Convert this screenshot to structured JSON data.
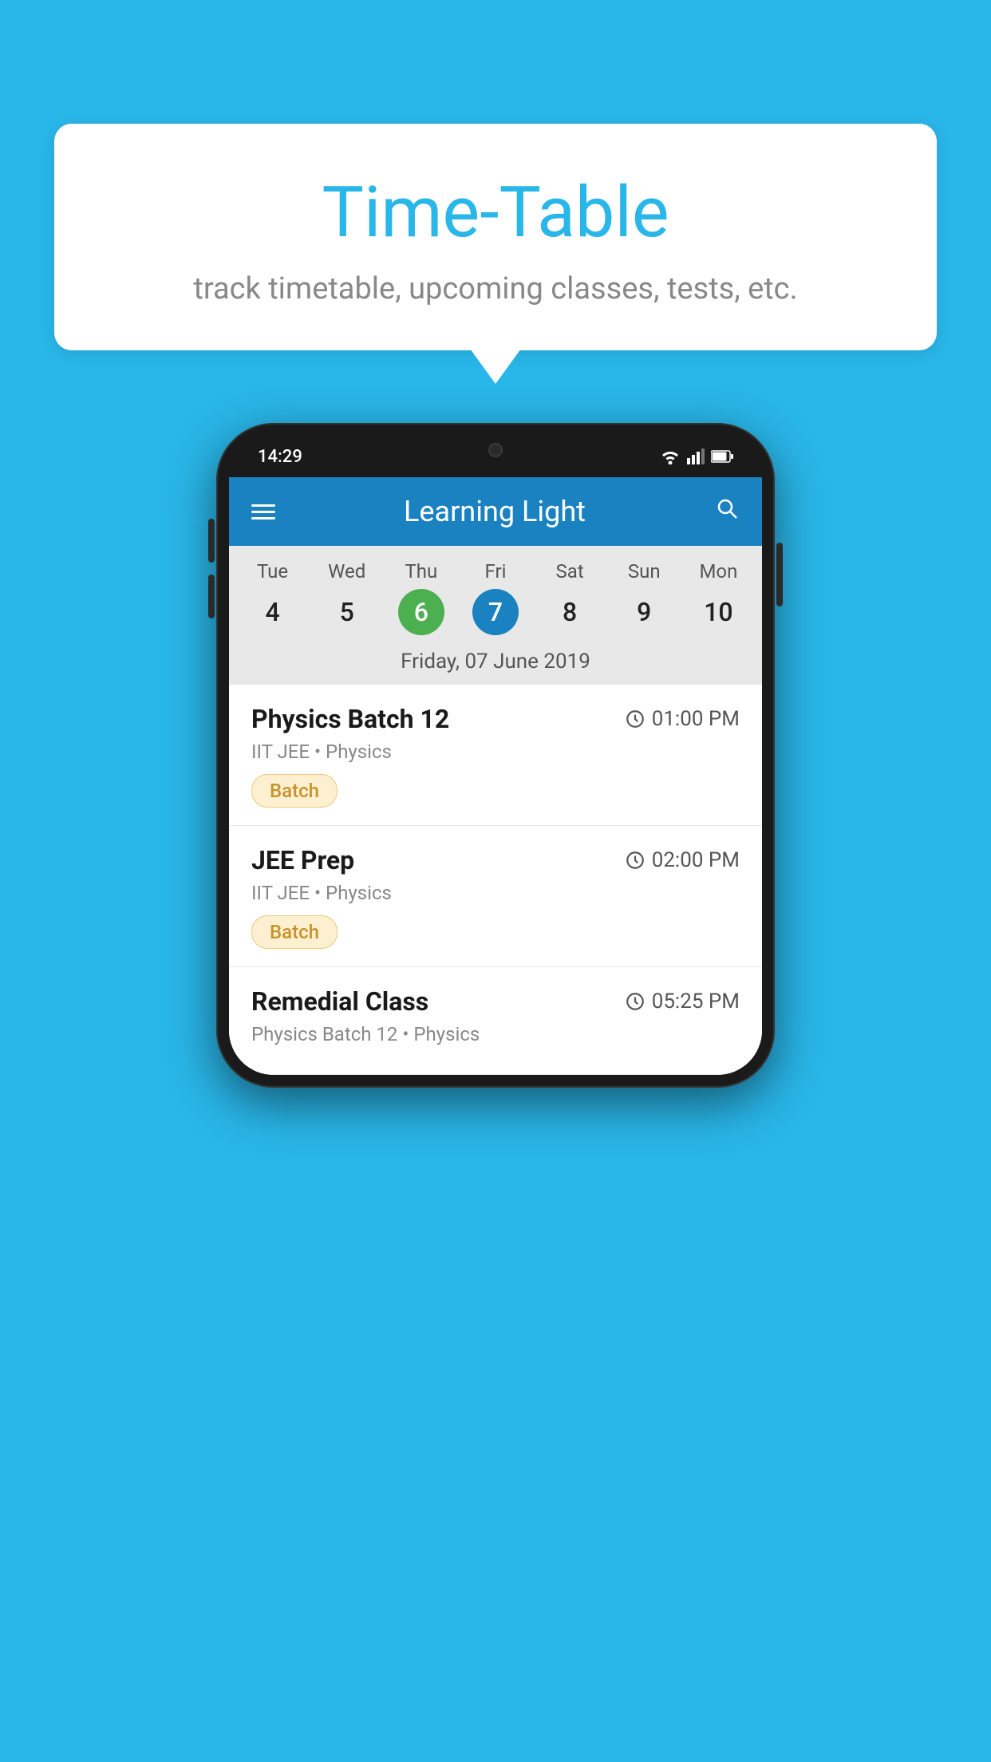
{
  "background_color": "#29b6e8",
  "speech_bubble": {
    "title": "Time-Table",
    "subtitle": "track timetable, upcoming classes, tests, etc."
  },
  "phone": {
    "status_bar": {
      "time": "14:29"
    },
    "header": {
      "title": "Learning Light"
    },
    "calendar": {
      "days": [
        {
          "name": "Tue",
          "number": "4",
          "state": "normal"
        },
        {
          "name": "Wed",
          "number": "5",
          "state": "normal"
        },
        {
          "name": "Thu",
          "number": "6",
          "state": "today"
        },
        {
          "name": "Fri",
          "number": "7",
          "state": "selected"
        },
        {
          "name": "Sat",
          "number": "8",
          "state": "normal"
        },
        {
          "name": "Sun",
          "number": "9",
          "state": "normal"
        },
        {
          "name": "Mon",
          "number": "10",
          "state": "normal"
        }
      ],
      "selected_date_label": "Friday, 07 June 2019"
    },
    "events": [
      {
        "title": "Physics Batch 12",
        "time": "01:00 PM",
        "category": "IIT JEE • Physics",
        "badge": "Batch"
      },
      {
        "title": "JEE Prep",
        "time": "02:00 PM",
        "category": "IIT JEE • Physics",
        "badge": "Batch"
      },
      {
        "title": "Remedial Class",
        "time": "05:25 PM",
        "category": "Physics Batch 12 • Physics",
        "badge": null
      }
    ]
  }
}
